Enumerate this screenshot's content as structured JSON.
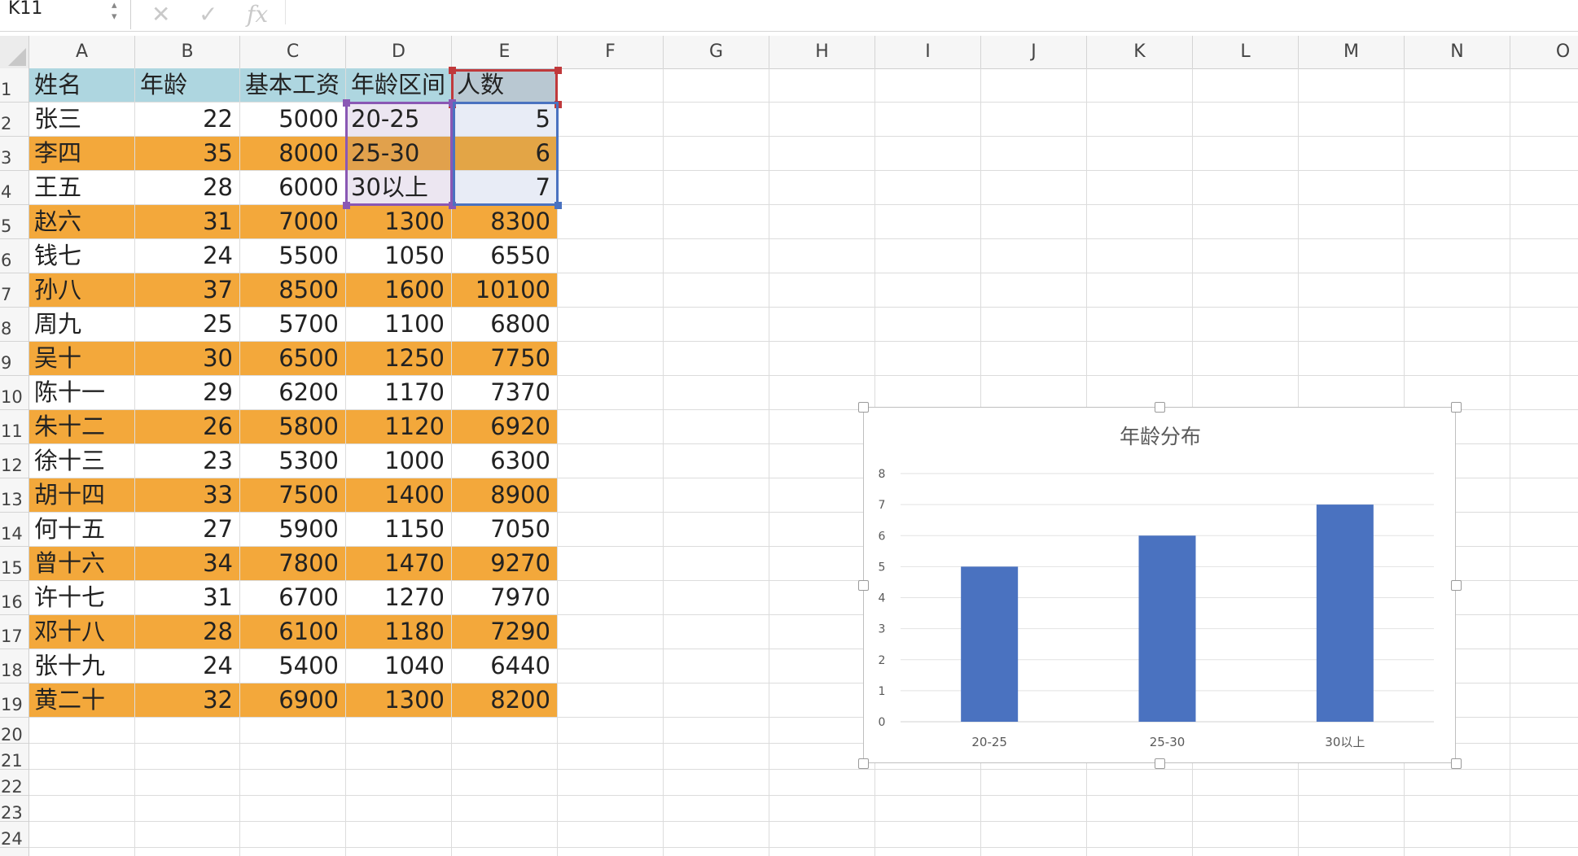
{
  "name_box": {
    "value": "K11"
  },
  "formula_bar": {
    "cancel_icon": "x-icon",
    "enter_icon": "check-icon",
    "fx_label": "fx",
    "value": ""
  },
  "columns": [
    "A",
    "B",
    "C",
    "D",
    "E",
    "F",
    "G",
    "H",
    "I",
    "J",
    "K",
    "L",
    "M",
    "N",
    "O"
  ],
  "rows": [
    "1",
    "2",
    "3",
    "4",
    "5",
    "6",
    "7",
    "8",
    "9",
    "10",
    "11",
    "12",
    "13",
    "14",
    "15",
    "16",
    "17",
    "18",
    "19",
    "20",
    "21",
    "22",
    "23",
    "24"
  ],
  "header_row": [
    "姓名",
    "年龄",
    "基本工资",
    "年龄区间",
    "人数"
  ],
  "data_rows": [
    {
      "name": "张三",
      "age": "22",
      "base": "5000",
      "d": "20-25",
      "e": "5"
    },
    {
      "name": "李四",
      "age": "35",
      "base": "8000",
      "d": "25-30",
      "e": "6"
    },
    {
      "name": "王五",
      "age": "28",
      "base": "6000",
      "d": "30以上",
      "e": "7"
    },
    {
      "name": "赵六",
      "age": "31",
      "base": "7000",
      "d": "1300",
      "e": "8300"
    },
    {
      "name": "钱七",
      "age": "24",
      "base": "5500",
      "d": "1050",
      "e": "6550"
    },
    {
      "name": "孙八",
      "age": "37",
      "base": "8500",
      "d": "1600",
      "e": "10100"
    },
    {
      "name": "周九",
      "age": "25",
      "base": "5700",
      "d": "1100",
      "e": "6800"
    },
    {
      "name": "吴十",
      "age": "30",
      "base": "6500",
      "d": "1250",
      "e": "7750"
    },
    {
      "name": "陈十一",
      "age": "29",
      "base": "6200",
      "d": "1170",
      "e": "7370"
    },
    {
      "name": "朱十二",
      "age": "26",
      "base": "5800",
      "d": "1120",
      "e": "6920"
    },
    {
      "name": "徐十三",
      "age": "23",
      "base": "5300",
      "d": "1000",
      "e": "6300"
    },
    {
      "name": "胡十四",
      "age": "33",
      "base": "7500",
      "d": "1400",
      "e": "8900"
    },
    {
      "name": "何十五",
      "age": "27",
      "base": "5900",
      "d": "1150",
      "e": "7050"
    },
    {
      "name": "曾十六",
      "age": "34",
      "base": "7800",
      "d": "1470",
      "e": "9270"
    },
    {
      "name": "许十七",
      "age": "31",
      "base": "6700",
      "d": "1270",
      "e": "7970"
    },
    {
      "name": "邓十八",
      "age": "28",
      "base": "6100",
      "d": "1180",
      "e": "7290"
    },
    {
      "name": "张十九",
      "age": "24",
      "base": "5400",
      "d": "1040",
      "e": "6440"
    },
    {
      "name": "黄二十",
      "age": "32",
      "base": "6900",
      "d": "1300",
      "e": "8200"
    }
  ],
  "colors": {
    "header_fill": "#aed6e0",
    "alt_row_fill": "#f3a83b",
    "bar": "#4a72c0"
  },
  "chart_data": {
    "type": "bar",
    "title": "年龄分布",
    "categories": [
      "20-25",
      "25-30",
      "30以上"
    ],
    "values": [
      5,
      6,
      7
    ],
    "ylim": [
      0,
      8
    ],
    "yticks": [
      "0",
      "1",
      "2",
      "3",
      "4",
      "5",
      "6",
      "7",
      "8"
    ],
    "grid": true,
    "legend": "none"
  }
}
